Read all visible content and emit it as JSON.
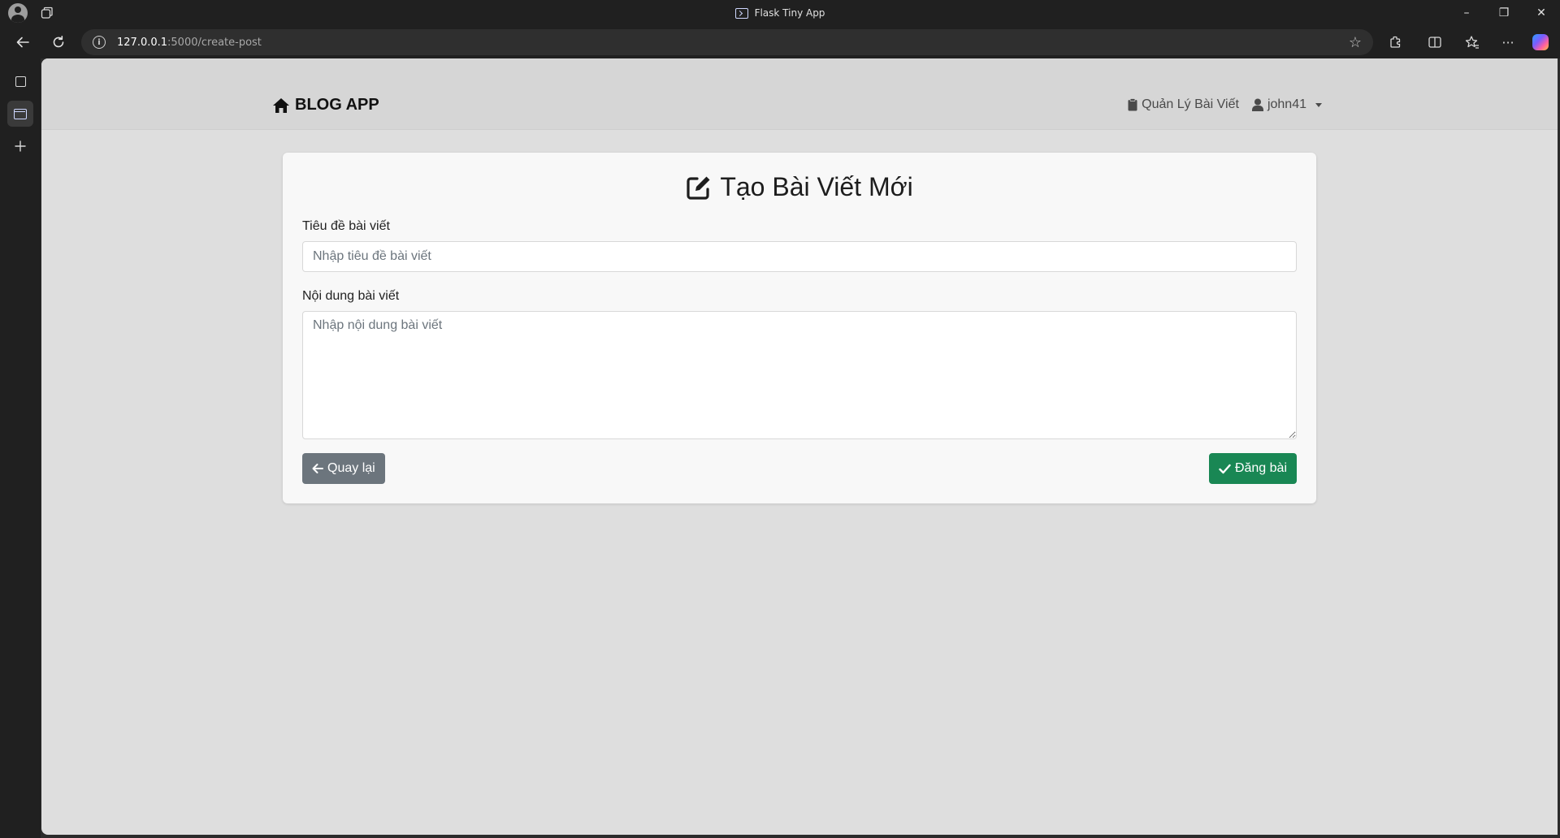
{
  "browser": {
    "window_title": "Flask Tiny App",
    "url_host": "127.0.0.1",
    "url_path": ":5000/create-post",
    "window_controls": {
      "minimize": "–",
      "restore": "❐",
      "close": "✕"
    }
  },
  "toolbar_icons": [
    "back-arrow-icon",
    "refresh-icon",
    "info-icon",
    "favorite-star-icon",
    "extensions-icon",
    "split-screen-icon",
    "favorites-icon",
    "more-icon",
    "copilot-icon"
  ],
  "navbar": {
    "brand": "BLOG APP",
    "manage_posts": "Quản Lý Bài Viết",
    "username": "john41"
  },
  "form": {
    "heading": "Tạo Bài Viết Mới",
    "title_label": "Tiêu đề bài viết",
    "title_placeholder": "Nhập tiêu đề bài viết",
    "content_label": "Nội dung bài viết",
    "content_placeholder": "Nhập nội dung bài viết",
    "back_button": "Quay lại",
    "submit_button": "Đăng bài"
  },
  "colors": {
    "back_button": "#6c757d",
    "submit_button": "#198754",
    "page_background": "#dedede",
    "navbar_background": "#d6d6d6"
  }
}
